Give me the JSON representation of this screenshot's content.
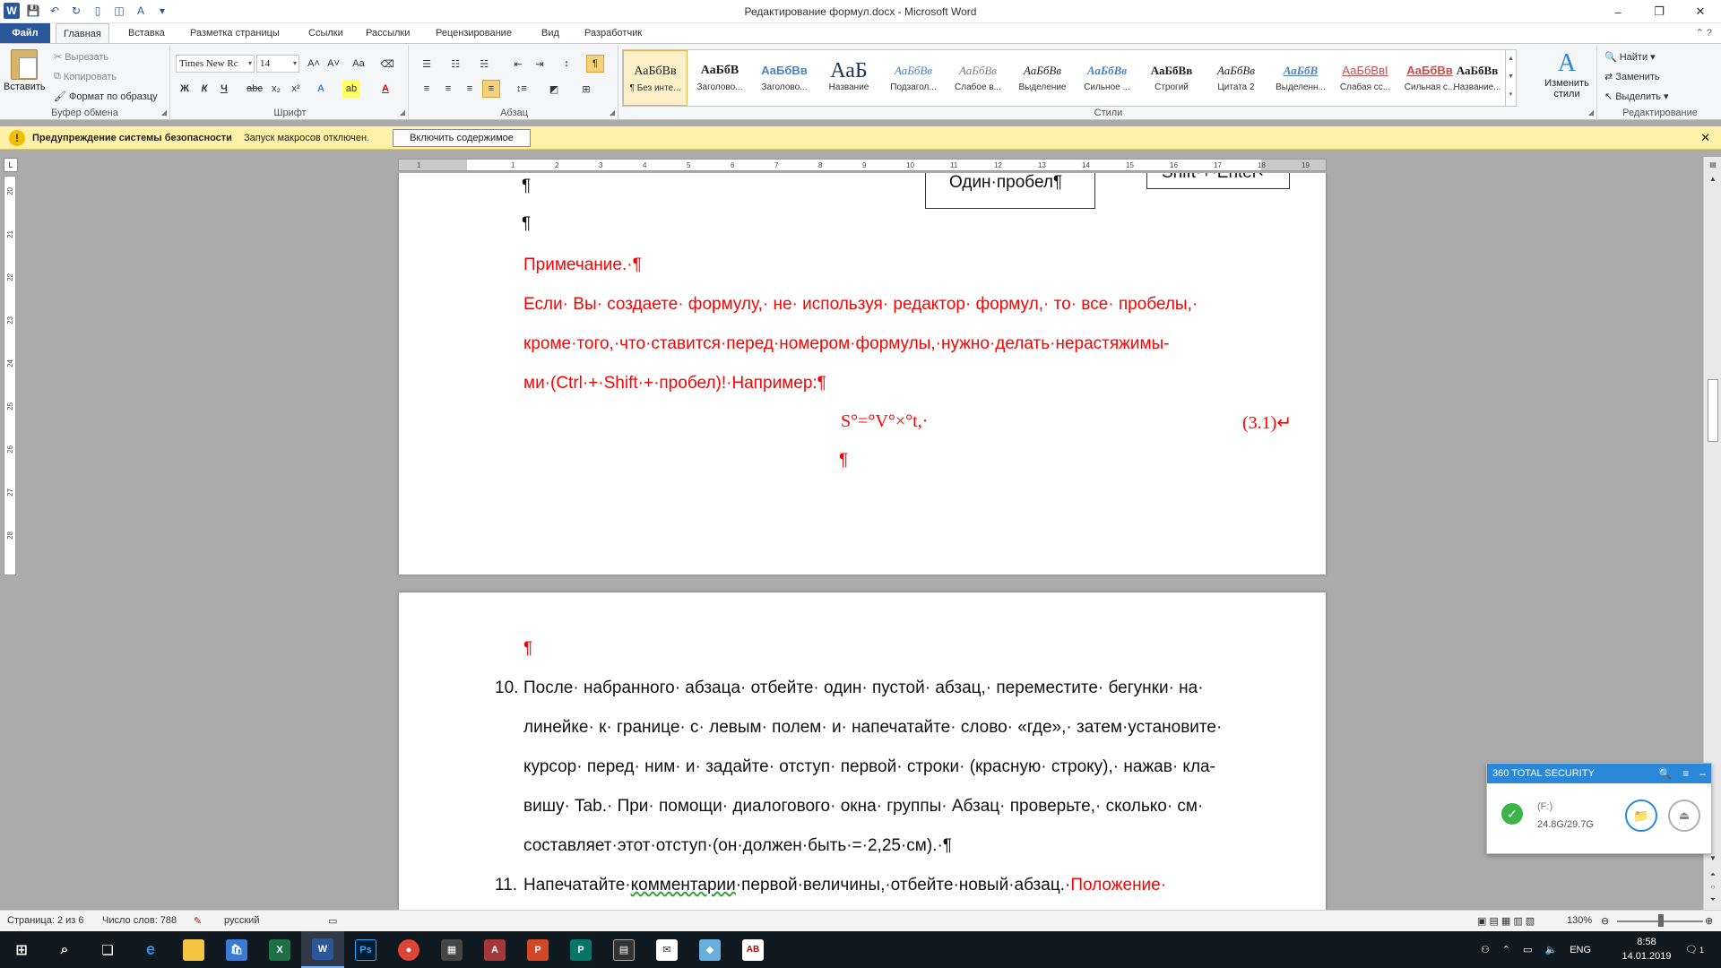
{
  "window": {
    "title": "Редактирование формул.docx - Microsoft Word",
    "minimize": "–",
    "restore": "❐",
    "close": "✕"
  },
  "qat": {
    "logo": "W",
    "save": "💾",
    "undo": "↶",
    "redo": "↻",
    "new": "▯",
    "print": "◫",
    "spell": "A",
    "more": "▾"
  },
  "tabs": [
    "Файл",
    "Главная",
    "Вставка",
    "Разметка страницы",
    "Ссылки",
    "Рассылки",
    "Рецензирование",
    "Вид",
    "Разработчик"
  ],
  "ribbon": {
    "clipboard": {
      "label": "Буфер обмена",
      "paste": "Вставить",
      "cut": "Вырезать",
      "copy": "Копировать",
      "format_painter": "Формат по образцу"
    },
    "font": {
      "label": "Шрифт",
      "font_name": "Times New Rc",
      "font_size": "14",
      "grow": "A˄",
      "shrink": "A˅",
      "case": "Aa",
      "clear": "⌫",
      "bold": "Ж",
      "italic": "К",
      "underline": "Ч",
      "strike": "abc",
      "sub": "x₂",
      "sup": "x²",
      "effects": "A",
      "highlight": "ab",
      "color": "A"
    },
    "paragraph": {
      "label": "Абзац",
      "bullets": "☰",
      "numbering": "☷",
      "multilevel": "☵",
      "dec_indent": "⇤",
      "inc_indent": "⇥",
      "sort": "↕",
      "pilcrow": "¶",
      "align_left": "≡",
      "align_center": "≡",
      "align_right": "≡",
      "justify": "≡",
      "spacing": "↕≡",
      "shading": "◩",
      "borders": "⊞"
    },
    "styles": {
      "label": "Стили",
      "items": [
        {
          "sample": "АаБбВв",
          "name": "¶ Без инте..."
        },
        {
          "sample": "АаБбВ",
          "name": "Заголово..."
        },
        {
          "sample": "АаБбВв",
          "name": "Заголово..."
        },
        {
          "sample": "АаБ",
          "name": "Название"
        },
        {
          "sample": "АаБбВв",
          "name": "Подзагол..."
        },
        {
          "sample": "АаБбВв",
          "name": "Слабое в..."
        },
        {
          "sample": "АаБбВв",
          "name": "Выделение"
        },
        {
          "sample": "АаБбВв",
          "name": "Сильное ..."
        },
        {
          "sample": "АаБбВв",
          "name": "Строгий"
        },
        {
          "sample": "АаБбВв",
          "name": "Цитата 2"
        },
        {
          "sample": "АаБбВ",
          "name": "Выделенн..."
        },
        {
          "sample": "АаБбВвI",
          "name": "Слабая сс..."
        },
        {
          "sample": "АаБбВв",
          "name": "Сильная с..."
        },
        {
          "sample": "АаБбВв",
          "name": "Название..."
        }
      ],
      "change_styles": "Изменить стили"
    },
    "editing": {
      "label": "Редактирование",
      "find": "Найти",
      "replace": "Заменить",
      "select": "Выделить"
    }
  },
  "security_bar": {
    "title": "Предупреждение системы безопасности",
    "message": "Запуск макросов отключен.",
    "button": "Включить содержимое",
    "close": "✕"
  },
  "ruler": {
    "h_ticks": [
      "1",
      "1",
      "2",
      "3",
      "4",
      "5",
      "6",
      "7",
      "8",
      "9",
      "10",
      "11",
      "12",
      "13",
      "14",
      "15",
      "16",
      "17",
      "18",
      "19"
    ],
    "v_ticks": [
      "20",
      "21",
      "22",
      "23",
      "24",
      "25",
      "26",
      "27",
      "28"
    ]
  },
  "document": {
    "page1": {
      "frame1": "Один·пробел¶",
      "frame2": "Shift·+·Enter↵",
      "empty_para": "¶",
      "note_title": "Примечание.·¶",
      "note_lines": [
        "Если· Вы· создаете· формулу,· не· используя· редактор· формул,· то· все· пробелы,·",
        "кроме·того,·что·ставится·перед·номером·формулы,·нужно·делать·нерастяжимы-",
        "ми·(Ctrl·+·Shift·+·пробел)!·Например:¶"
      ],
      "formula": "S°=°V°×°t,·",
      "formula_number": "(3.1)↵",
      "after_formula": "¶"
    },
    "page2": {
      "empty_para": "¶",
      "item10_number": "10.",
      "item10_lines": [
        "После· набранного· абзаца· отбейте· один· пустой· абзац,· переместите· бегунки· на·",
        "линейке· к· границе· с· левым· полем· и· напечатайте· слово· «где»,· затем·установите·",
        "курсор· перед· ним· и· задайте· отступ· первой· строки· (красную· строку),· нажав· кла-",
        "вишу· Tab.· При· помощи· диалогового· окна· группы· Абзац· проверьте,· сколько· см·",
        "составляет·этот·отступ·(он·должен·быть·=·2,25·см).·¶"
      ],
      "item11_number": "11.",
      "item11_a": "Напечатайте·",
      "item11_b": "комментарии",
      "item11_c": "·первой·величины,·отбейте·новый·абзац.·",
      "item11_d": "Положение·"
    }
  },
  "popup": {
    "title": "360 TOTAL SECURITY",
    "drive": "(F:)",
    "size": "24.8G/29.7G",
    "check": "✓",
    "folder": "📁",
    "eject": "⏏",
    "search": "🔍",
    "menu": "≡",
    "min": "–"
  },
  "statusbar": {
    "page": "Страница: 2 из 6",
    "words": "Число слов: 788",
    "lang": "русский",
    "zoom": "130%"
  },
  "taskbar": {
    "lang": "ENG",
    "time": "8:58",
    "date": "14.01.2019",
    "notify": "1"
  }
}
